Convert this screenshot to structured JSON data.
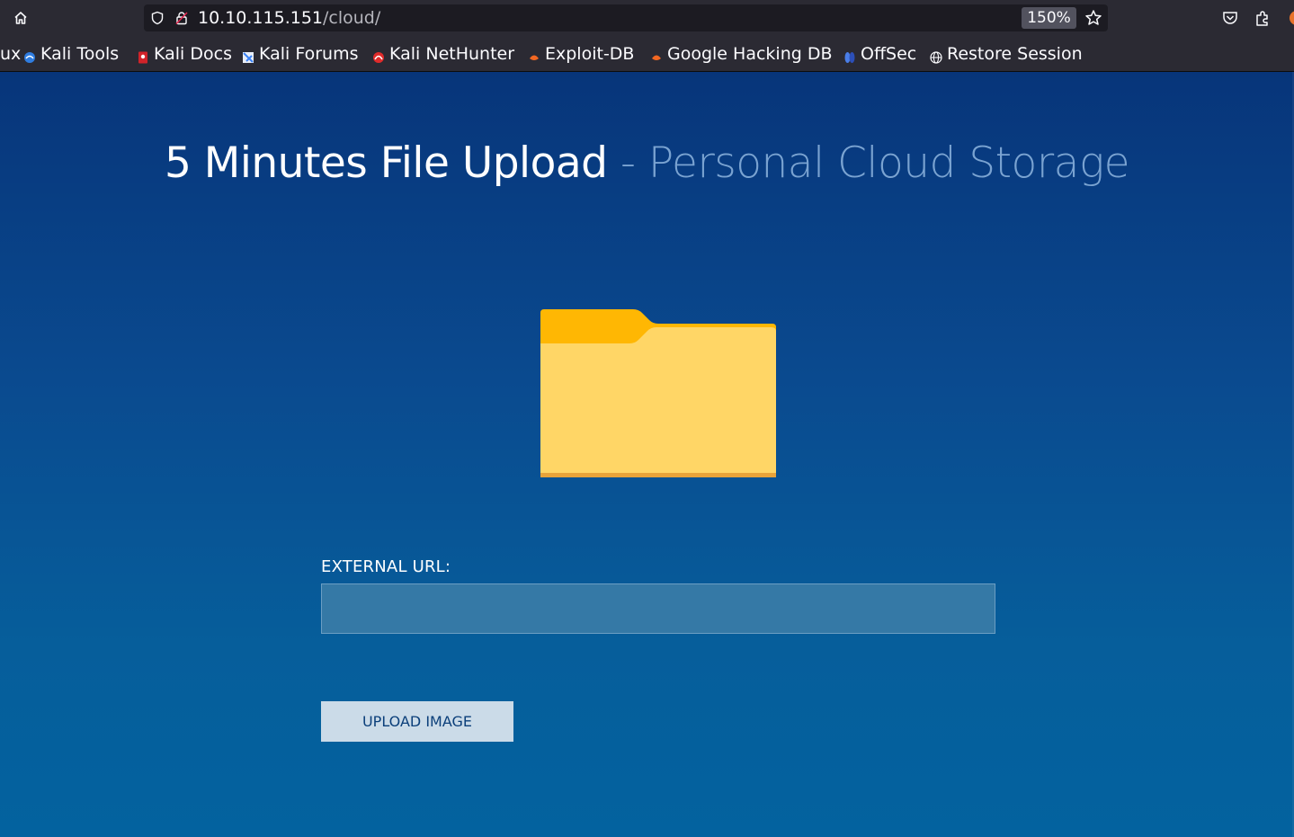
{
  "browser": {
    "url_host": "10.10.115.151",
    "url_path": "/cloud/",
    "zoom": "150%",
    "toolbar_icons": [
      "home-icon",
      "shield-icon",
      "lock-insecure-icon",
      "star-icon",
      "pocket-icon",
      "extensions-icon"
    ]
  },
  "bookmarks": [
    {
      "label": "ux",
      "icon": "kali-linux-icon"
    },
    {
      "label": "Kali Tools",
      "icon": "kali-tools-icon",
      "color": "#2f7de1"
    },
    {
      "label": "Kali Docs",
      "icon": "kali-docs-icon",
      "color": "#d1232a"
    },
    {
      "label": "Kali Forums",
      "icon": "kali-forums-icon",
      "color": "#3b82f6"
    },
    {
      "label": "Kali NetHunter",
      "icon": "kali-nethunter-icon",
      "color": "#e02b2b"
    },
    {
      "label": "Exploit-DB",
      "icon": "exploit-db-icon",
      "color": "#f26722"
    },
    {
      "label": "Google Hacking DB",
      "icon": "ghdb-icon",
      "color": "#f26722"
    },
    {
      "label": "OffSec",
      "icon": "offsec-icon",
      "color": "#4a7ee8"
    },
    {
      "label": "Restore Session",
      "icon": "globe-icon"
    }
  ],
  "page": {
    "title_main": "5 Minutes File Upload",
    "title_sub": "- Personal Cloud Storage",
    "folder_icon": "folder-icon",
    "external_url_label": "EXTERNAL URL:",
    "external_url_value": "",
    "upload_button_label": "UPLOAD IMAGE",
    "colors": {
      "background_top": "#07357a",
      "background_bottom": "#03629f",
      "input_bg": "#3579a6",
      "button_bg": "#cbdbe8",
      "button_text": "#0b3f7a",
      "folder_front": "#ffd666",
      "folder_tab": "#ffb703"
    }
  }
}
